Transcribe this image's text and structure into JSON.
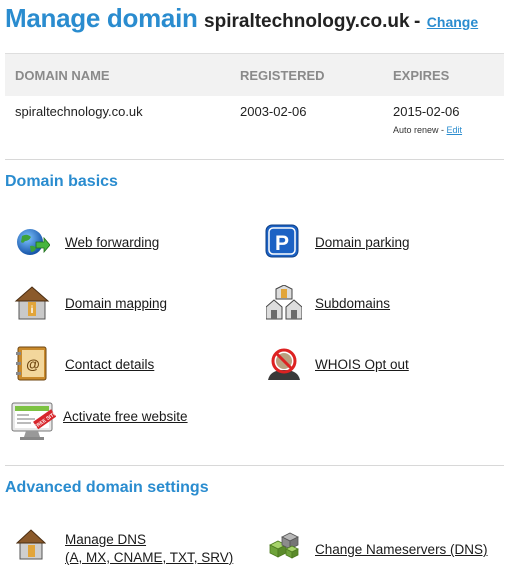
{
  "header": {
    "title": "Manage domain",
    "domain": "spiraltechnology.co.uk",
    "separator": "-",
    "change_link": "Change"
  },
  "table": {
    "columns": [
      "DOMAIN NAME",
      "REGISTERED",
      "EXPIRES"
    ],
    "row": {
      "domain": "spiraltechnology.co.uk",
      "registered": "2003-02-06",
      "expires": "2015-02-06",
      "auto_renew_label": "Auto renew -",
      "edit_link": "Edit"
    }
  },
  "domain_basics": {
    "title": "Domain basics",
    "items": [
      {
        "label": "Web forwarding",
        "icon": "globe-arrow-icon"
      },
      {
        "label": "Domain parking",
        "icon": "parking-sign-icon"
      },
      {
        "label": "Domain mapping",
        "icon": "house-map-icon"
      },
      {
        "label": "Subdomains",
        "icon": "houses-icon"
      },
      {
        "label": "Contact details",
        "icon": "address-book-icon"
      },
      {
        "label": "WHOIS Opt out",
        "icon": "privacy-block-icon"
      },
      {
        "label": "Activate free website",
        "icon": "monitor-free-site-icon",
        "badge": "FREE SITE"
      }
    ]
  },
  "advanced": {
    "title": "Advanced domain settings",
    "items": [
      {
        "label_line1": "Manage DNS",
        "label_line2": "(A, MX, CNAME, TXT, SRV)",
        "icon": "house-dns-icon"
      },
      {
        "label": "Change Nameservers (DNS)",
        "icon": "server-cubes-icon"
      }
    ]
  },
  "colors": {
    "accent": "#2a8ccf",
    "header_bg": "#f2f2f2",
    "column_header_text": "#8a8a8a"
  }
}
